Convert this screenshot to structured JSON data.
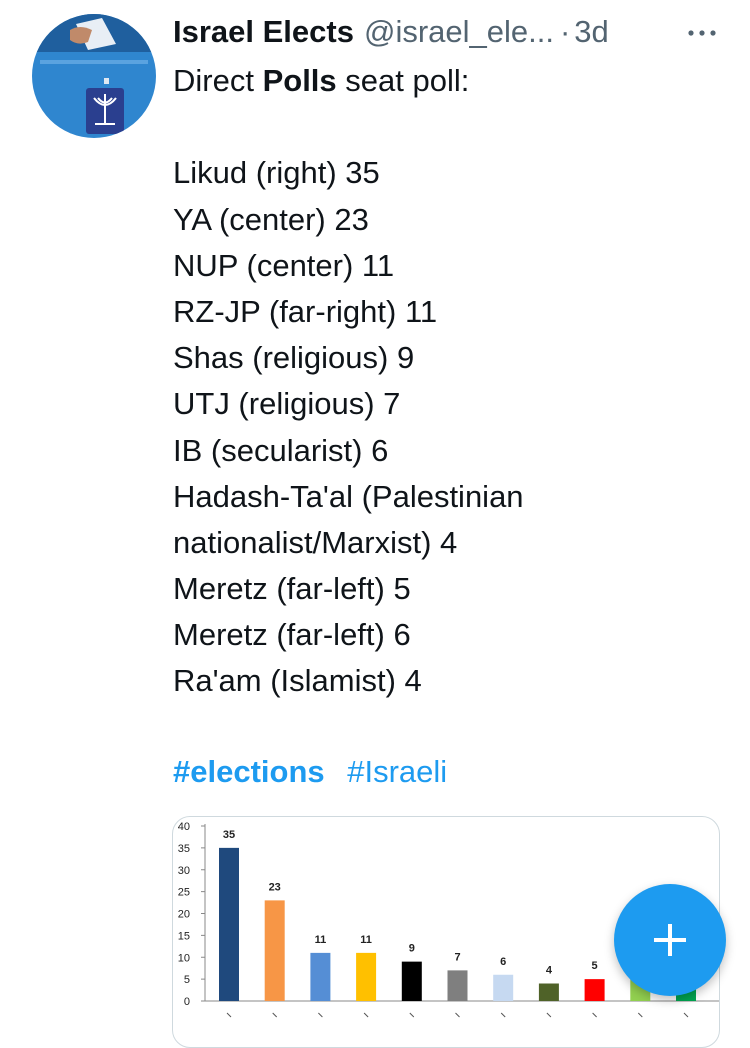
{
  "tweet": {
    "author_name": "Israel Elects",
    "handle": "@israel_ele...",
    "separator": "·",
    "time": "3d",
    "intro": {
      "before": "Direct ",
      "bold": "Polls",
      "after": " seat poll:"
    },
    "lines": [
      "Likud (right) 35",
      "YA (center) 23",
      "NUP (center) 11",
      "RZ-JP (far-right) 11",
      "Shas (religious) 9",
      "UTJ (religious) 7",
      "IB (secularist) 6",
      "Hadash-Ta'al (Palestinian",
      "nationalist/Marxist) 4",
      "Meretz (far-left) 5",
      "Meretz (far-left) 6",
      "Ra'am (Islamist) 4"
    ],
    "hashtags": [
      "#elections",
      "#Israeli"
    ]
  },
  "colors": {
    "accent": "#1d9bf0",
    "avatar_bg": "#2f86cf",
    "emblem": "#2a3f8f"
  },
  "chart_data": {
    "type": "bar",
    "ylim": [
      0,
      40
    ],
    "y_ticks": [
      "0",
      "5",
      "10",
      "15",
      "20",
      "25",
      "30",
      "35",
      "40"
    ],
    "values": [
      35,
      23,
      11,
      11,
      9,
      7,
      6,
      4,
      5,
      6,
      4
    ],
    "value_labels": [
      "35",
      "23",
      "11",
      "11",
      "9",
      "7",
      "6",
      "4",
      "5",
      "",
      ""
    ],
    "bar_colors": [
      "#1f497d",
      "#f79646",
      "#558ed5",
      "#ffc000",
      "#000000",
      "#7f7f7f",
      "#c6d9f1",
      "#4f6228",
      "#ff0000",
      "#92d050",
      "#00a651"
    ]
  },
  "fab": {
    "icon": "plus-icon"
  }
}
